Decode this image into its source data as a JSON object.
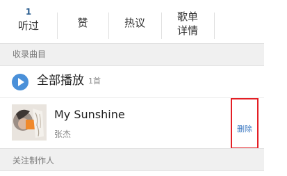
{
  "tabs": [
    {
      "count": "1",
      "label_lines": [
        "听过"
      ]
    },
    {
      "count": "",
      "label_lines": [
        "赞"
      ]
    },
    {
      "count": "",
      "label_lines": [
        "热议"
      ]
    },
    {
      "count": "",
      "label_lines": [
        "歌单",
        "详情"
      ]
    }
  ],
  "sections": {
    "collected": "收录曲目",
    "follow_producer": "关注制作人"
  },
  "play_all": {
    "label": "全部播放",
    "count": "1首"
  },
  "songs": [
    {
      "title": "My Sunshine",
      "artist": "张杰",
      "action": "删除"
    }
  ],
  "colors": {
    "accent": "#4a90d9",
    "highlight_border": "#e41f25",
    "link": "#3a77c1",
    "section_bg": "#f0f0f0"
  }
}
